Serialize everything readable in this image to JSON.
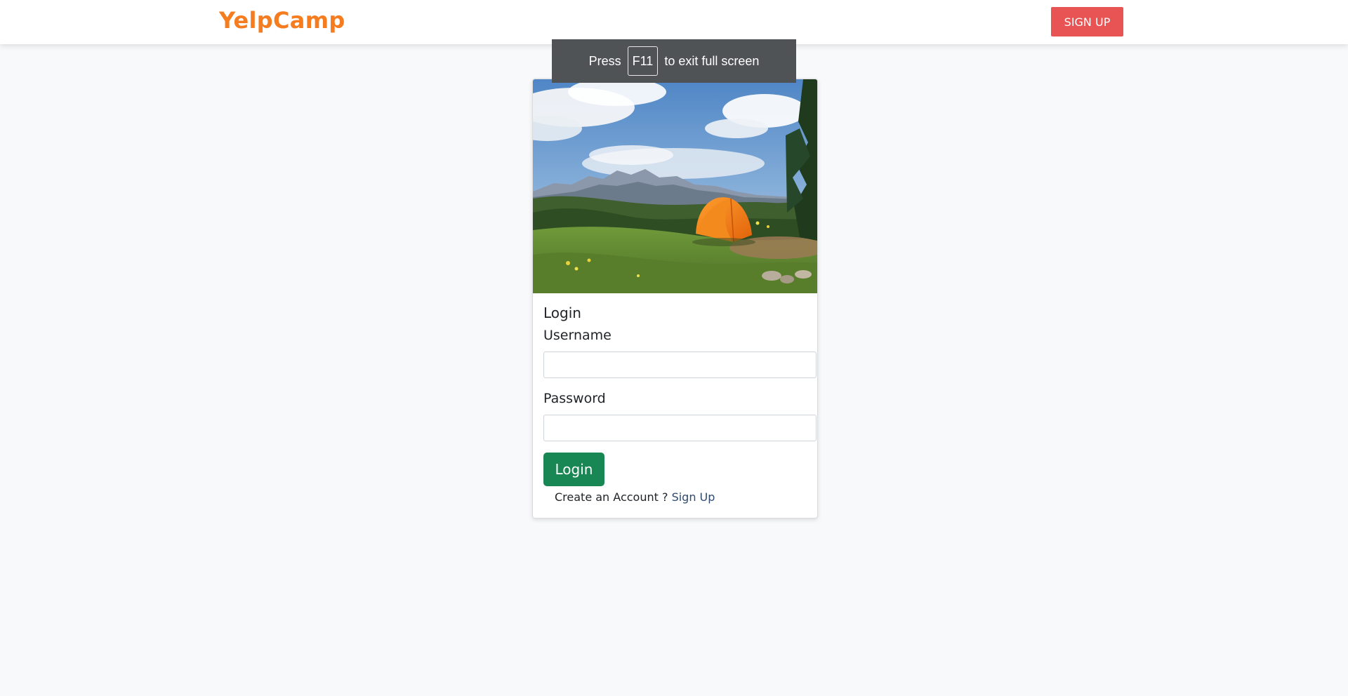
{
  "navbar": {
    "brand": "YelpCamp",
    "signup_label": "SIGN UP"
  },
  "fullscreen_toast": {
    "prefix": "Press",
    "key": "F11",
    "suffix": "to exit full screen"
  },
  "login_card": {
    "image": "campground-tent-mountains-photo",
    "title": "Login",
    "username_label": "Username",
    "username_value": "",
    "password_label": "Password",
    "password_value": "",
    "submit_label": "Login",
    "prompt_text": "Create an Account ?",
    "signup_link": "Sign Up"
  },
  "colors": {
    "brand": "#f57c1f",
    "signup_button": "#e85454",
    "login_button": "#198754",
    "page_background": "#f8f9fa"
  }
}
